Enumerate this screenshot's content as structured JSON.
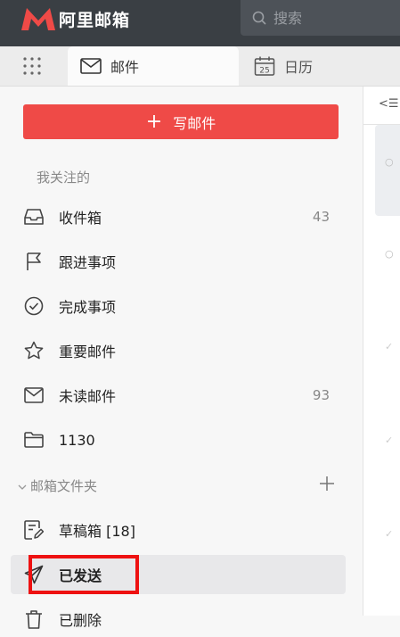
{
  "app": {
    "title": "阿里邮箱"
  },
  "search": {
    "placeholder": "搜索"
  },
  "tabs": [
    {
      "label": "邮件",
      "active": true,
      "icon": "mail-icon"
    },
    {
      "label": "日历",
      "active": false,
      "icon": "calendar-icon",
      "day": "25"
    }
  ],
  "compose": {
    "label": "写邮件"
  },
  "favorites": {
    "title": "我关注的",
    "items": [
      {
        "label": "收件箱",
        "count": "43",
        "icon": "inbox-icon"
      },
      {
        "label": "跟进事项",
        "count": "",
        "icon": "flag-icon"
      },
      {
        "label": "完成事项",
        "count": "",
        "icon": "check-circle-icon"
      },
      {
        "label": "重要邮件",
        "count": "",
        "icon": "star-icon"
      },
      {
        "label": "未读邮件",
        "count": "93",
        "icon": "envelope-icon"
      },
      {
        "label": "1130",
        "count": "",
        "icon": "folder-icon"
      }
    ]
  },
  "folders": {
    "title": "邮箱文件夹",
    "items": [
      {
        "label": "草稿箱 [18]",
        "icon": "draft-icon"
      },
      {
        "label": "已发送",
        "icon": "send-icon",
        "selected": true
      },
      {
        "label": "已删除",
        "icon": "trash-icon"
      }
    ]
  },
  "colors": {
    "accent": "#ef4a47",
    "topbar": "#3a3f44",
    "highlight": "#ee1111"
  }
}
